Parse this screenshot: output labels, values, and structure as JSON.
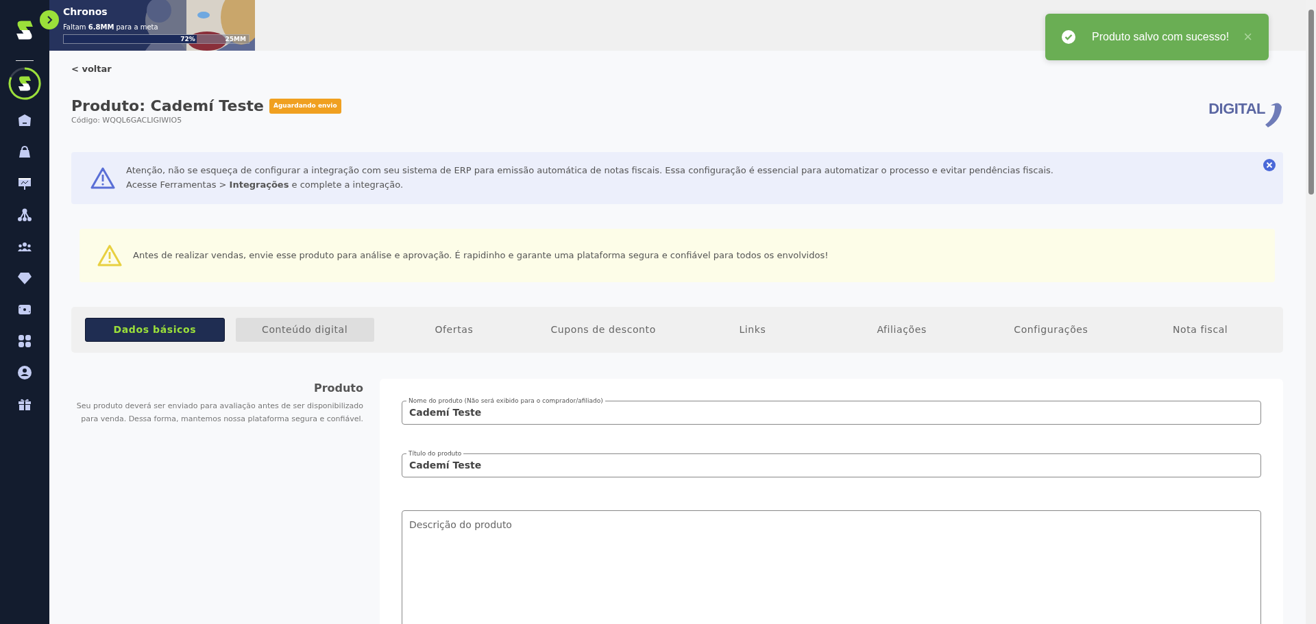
{
  "banner": {
    "title": "Chronos",
    "goal_text": "Faltam **6.8MM** para a meta",
    "progress": {
      "level": 0.72,
      "percent": "72%",
      "target": "25MM"
    }
  },
  "toast": {
    "message": "Produto salvo com sucesso!",
    "close": "×"
  },
  "back_link": "< voltar",
  "product": {
    "title": "Produto: Cademí Teste",
    "status_badge": "Aguardando envio",
    "code": "Código: WQQL6GACLIGIWIO5",
    "type_logo": "DIGITAL"
  },
  "alerts": [
    {
      "kind": "info",
      "lines": [
        "Atenção, não se esqueça de configurar a integração com seu sistema de ERP para emissão automática de notas fiscais. Essa configuração é essencial para automatizar o processo e evitar pendências fiscais.",
        "Acesse Ferramentas > **Integrações** e complete a integração."
      ],
      "dismissible": true
    },
    {
      "kind": "warning",
      "lines": [
        "Antes de realizar vendas, envie esse produto para análise e aprovação. É rapidinho e garante uma plataforma segura e confiável para todos os envolvidos!"
      ],
      "dismissible": false
    }
  ],
  "tabs": [
    {
      "label": "Dados básicos",
      "selected": true,
      "hovered": false
    },
    {
      "label": "Conteúdo digital",
      "selected": false,
      "hovered": true
    },
    {
      "label": "Ofertas",
      "selected": false,
      "hovered": false
    },
    {
      "label": "Cupons de desconto",
      "selected": false,
      "hovered": false
    },
    {
      "label": "Links",
      "selected": false,
      "hovered": false
    },
    {
      "label": "Afiliações",
      "selected": false,
      "hovered": false
    },
    {
      "label": "Configurações",
      "selected": false,
      "hovered": false
    },
    {
      "label": "Nota fiscal",
      "selected": false,
      "hovered": false
    }
  ],
  "section": {
    "title": "Produto",
    "description": "Seu produto deverá ser enviado para avaliação antes de ser disponibilizado para venda. Dessa forma, mantemos nossa plataforma segura e confiável."
  },
  "fields": [
    {
      "kind": "text",
      "label": "Nome do produto (Não será exibido para o comprador/afiliado)",
      "value": "Cademí Teste"
    },
    {
      "kind": "text",
      "label": "Título do produto",
      "value": "Cademí Teste"
    },
    {
      "kind": "textarea",
      "placeholder": "Descrição do produto"
    }
  ]
}
